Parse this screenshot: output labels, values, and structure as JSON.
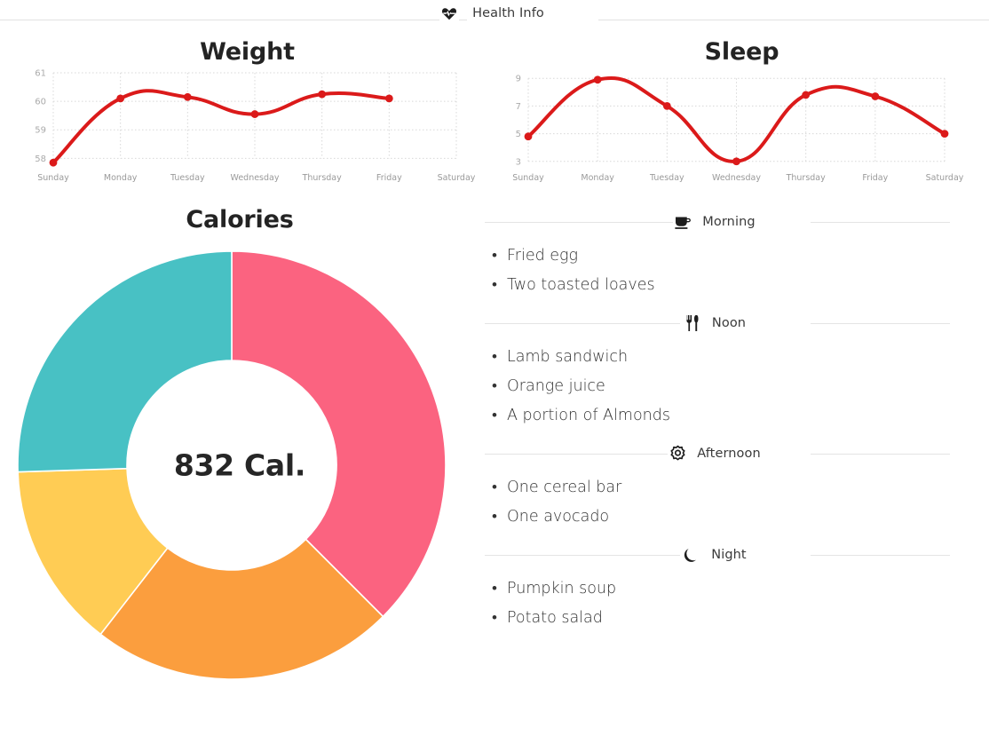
{
  "header": {
    "title": "Health Info",
    "icon": "heart-pulse-icon"
  },
  "theme": {
    "line_color": "#DB1A1A",
    "grid_color": "#d8d8d8",
    "axis_text_color": "#a8a8a8",
    "title_color": "#232323",
    "divider_color": "#e3e3e3"
  },
  "chart_data": [
    {
      "type": "line",
      "title": "Weight",
      "xlabel": "",
      "ylabel": "",
      "categories": [
        "Sunday",
        "Monday",
        "Tuesday",
        "Wednesday",
        "Thursday",
        "Friday",
        "Saturday"
      ],
      "values": [
        57.85,
        60.1,
        60.15,
        59.55,
        60.25,
        60.1,
        null
      ],
      "ytick_labels": [
        "61",
        "60",
        "59",
        "58"
      ],
      "yticks": [
        61,
        60,
        59,
        58
      ],
      "ylim": [
        57.7,
        61
      ],
      "grid": true,
      "legend": "none",
      "series_color": "#DB1A1A",
      "marker": "circle"
    },
    {
      "type": "line",
      "title": "Sleep",
      "xlabel": "",
      "ylabel": "",
      "categories": [
        "Sunday",
        "Monday",
        "Tuesday",
        "Wednesday",
        "Thursday",
        "Friday",
        "Saturday"
      ],
      "values": [
        4.8,
        8.9,
        7.0,
        3.0,
        7.8,
        7.7,
        5.0
      ],
      "ytick_labels": [
        "9",
        "7",
        "5",
        "3"
      ],
      "yticks": [
        9,
        7,
        5,
        3
      ],
      "ylim": [
        2.6,
        9.4
      ],
      "grid": true,
      "legend": "none",
      "series_color": "#DB1A1A",
      "marker": "circle"
    },
    {
      "type": "pie",
      "variant": "donut",
      "title": "Calories",
      "center_label": "832 Cal.",
      "total": 832,
      "start_angle_deg": 0,
      "direction": "clockwise",
      "slices": [
        {
          "label": "Morning",
          "percent": 37.5,
          "color": "#FB6380"
        },
        {
          "label": "Noon",
          "percent": 23.0,
          "color": "#FB9E3E"
        },
        {
          "label": "Afternoon",
          "percent": 14.0,
          "color": "#FFCC54"
        },
        {
          "label": "Night",
          "percent": 25.5,
          "color": "#48C1C4"
        }
      ]
    }
  ],
  "meals": [
    {
      "key": "morning",
      "label": "Morning",
      "icon": "coffee-cup-icon",
      "items": [
        "Fried egg",
        "Two toasted loaves"
      ]
    },
    {
      "key": "noon",
      "label": "Noon",
      "icon": "fork-knife-icon",
      "items": [
        "Lamb sandwich",
        "Orange juice",
        "A portion of Almonds"
      ]
    },
    {
      "key": "afternoon",
      "label": "Afternoon",
      "icon": "sun-icon",
      "items": [
        "One cereal bar",
        "One avocado"
      ]
    },
    {
      "key": "night",
      "label": "Night",
      "icon": "moon-icon",
      "items": [
        "Pumpkin soup",
        "Potato salad"
      ]
    }
  ]
}
